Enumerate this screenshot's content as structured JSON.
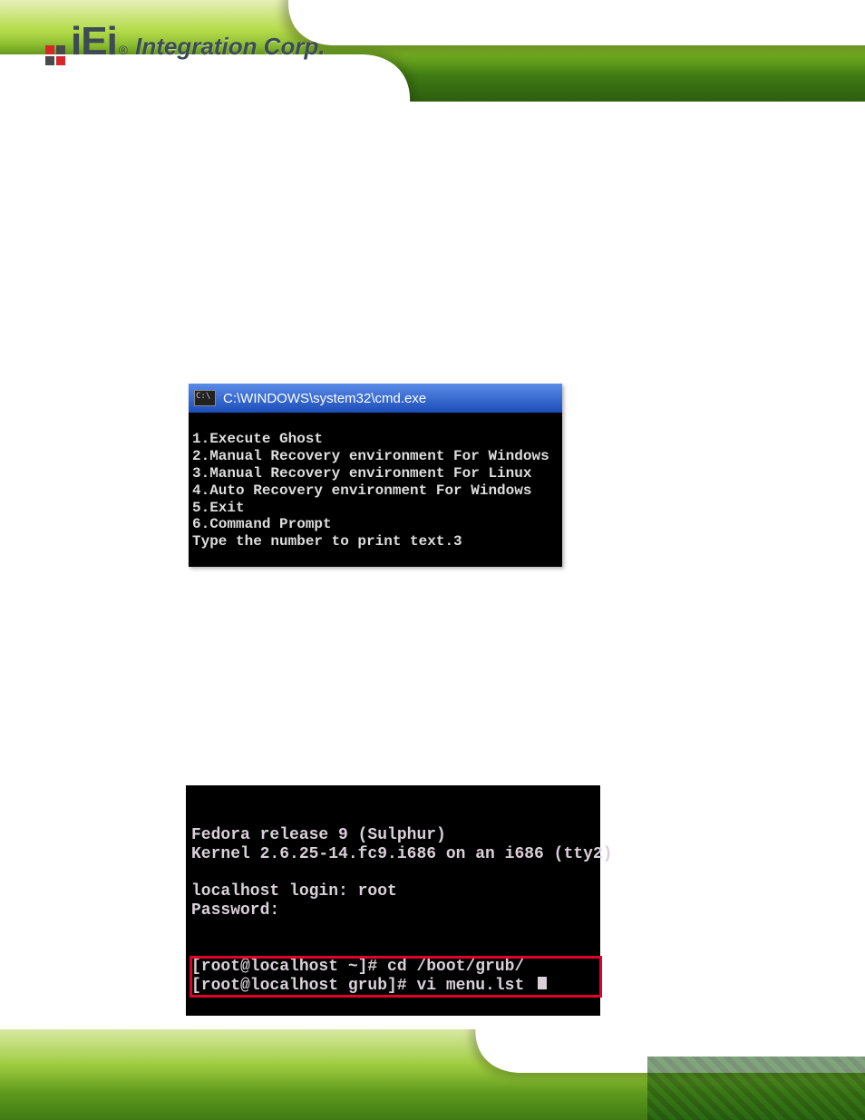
{
  "header": {
    "logo_text": "iEi",
    "logo_sub": "Integration Corp.",
    "reg": "®"
  },
  "screenshot1": {
    "title": "C:\\WINDOWS\\system32\\cmd.exe",
    "lines": [
      "1.Execute Ghost",
      "2.Manual Recovery environment For Windows",
      "3.Manual Recovery environment For Linux",
      "4.Auto Recovery environment For Windows",
      "5.Exit",
      "6.Command Prompt",
      "Type the number to print text.3"
    ]
  },
  "screenshot2": {
    "pre_lines": [
      "Fedora release 9 (Sulphur)",
      "Kernel 2.6.25-14.fc9.i686 on an i686 (tty2)",
      "",
      "localhost login: root",
      "Password:"
    ],
    "hl_lines": [
      "[root@localhost ~]# cd /boot/grub/",
      "[root@localhost grub]# vi menu.lst "
    ]
  }
}
